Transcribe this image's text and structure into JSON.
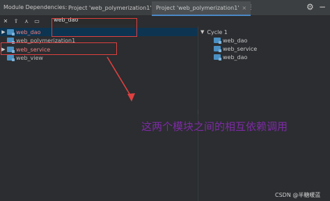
{
  "header": {
    "title": "Module Dependencies:",
    "tabs": [
      {
        "label": "Project 'web_polymerization1'",
        "close": "×"
      },
      {
        "label": "Project 'web_polymerization1'",
        "close": "×"
      }
    ],
    "more": "⋮",
    "settings_icon": "gear-icon",
    "minimize_icon": "minus-icon"
  },
  "toolbar": {
    "icons": [
      "close-icon",
      "upload-icon",
      "tree-icon",
      "folder-icon"
    ],
    "search_value": "web_dao"
  },
  "left_tree": [
    {
      "label": "web_dao",
      "expanded": false,
      "selected": true,
      "highlight": true
    },
    {
      "label": "web_polymerization1",
      "expanded": false,
      "selected": false,
      "highlight": false
    },
    {
      "label": "web_service",
      "expanded": false,
      "selected": false,
      "highlight": true
    },
    {
      "label": "web_view",
      "expanded": false,
      "selected": false,
      "highlight": false
    }
  ],
  "right_tree": {
    "cycle_label": "Cycle 1",
    "items": [
      "web_dao",
      "web_service",
      "web_dao"
    ]
  },
  "annotation": "这两个模块之间的相互依赖调用",
  "watermark": "CSDN @半糖暖蓝",
  "colors": {
    "annotation_red": "#e04040",
    "annotation_purple": "#7f2aa8",
    "selection": "#0d3552",
    "module_icon": "#4a90c2"
  }
}
